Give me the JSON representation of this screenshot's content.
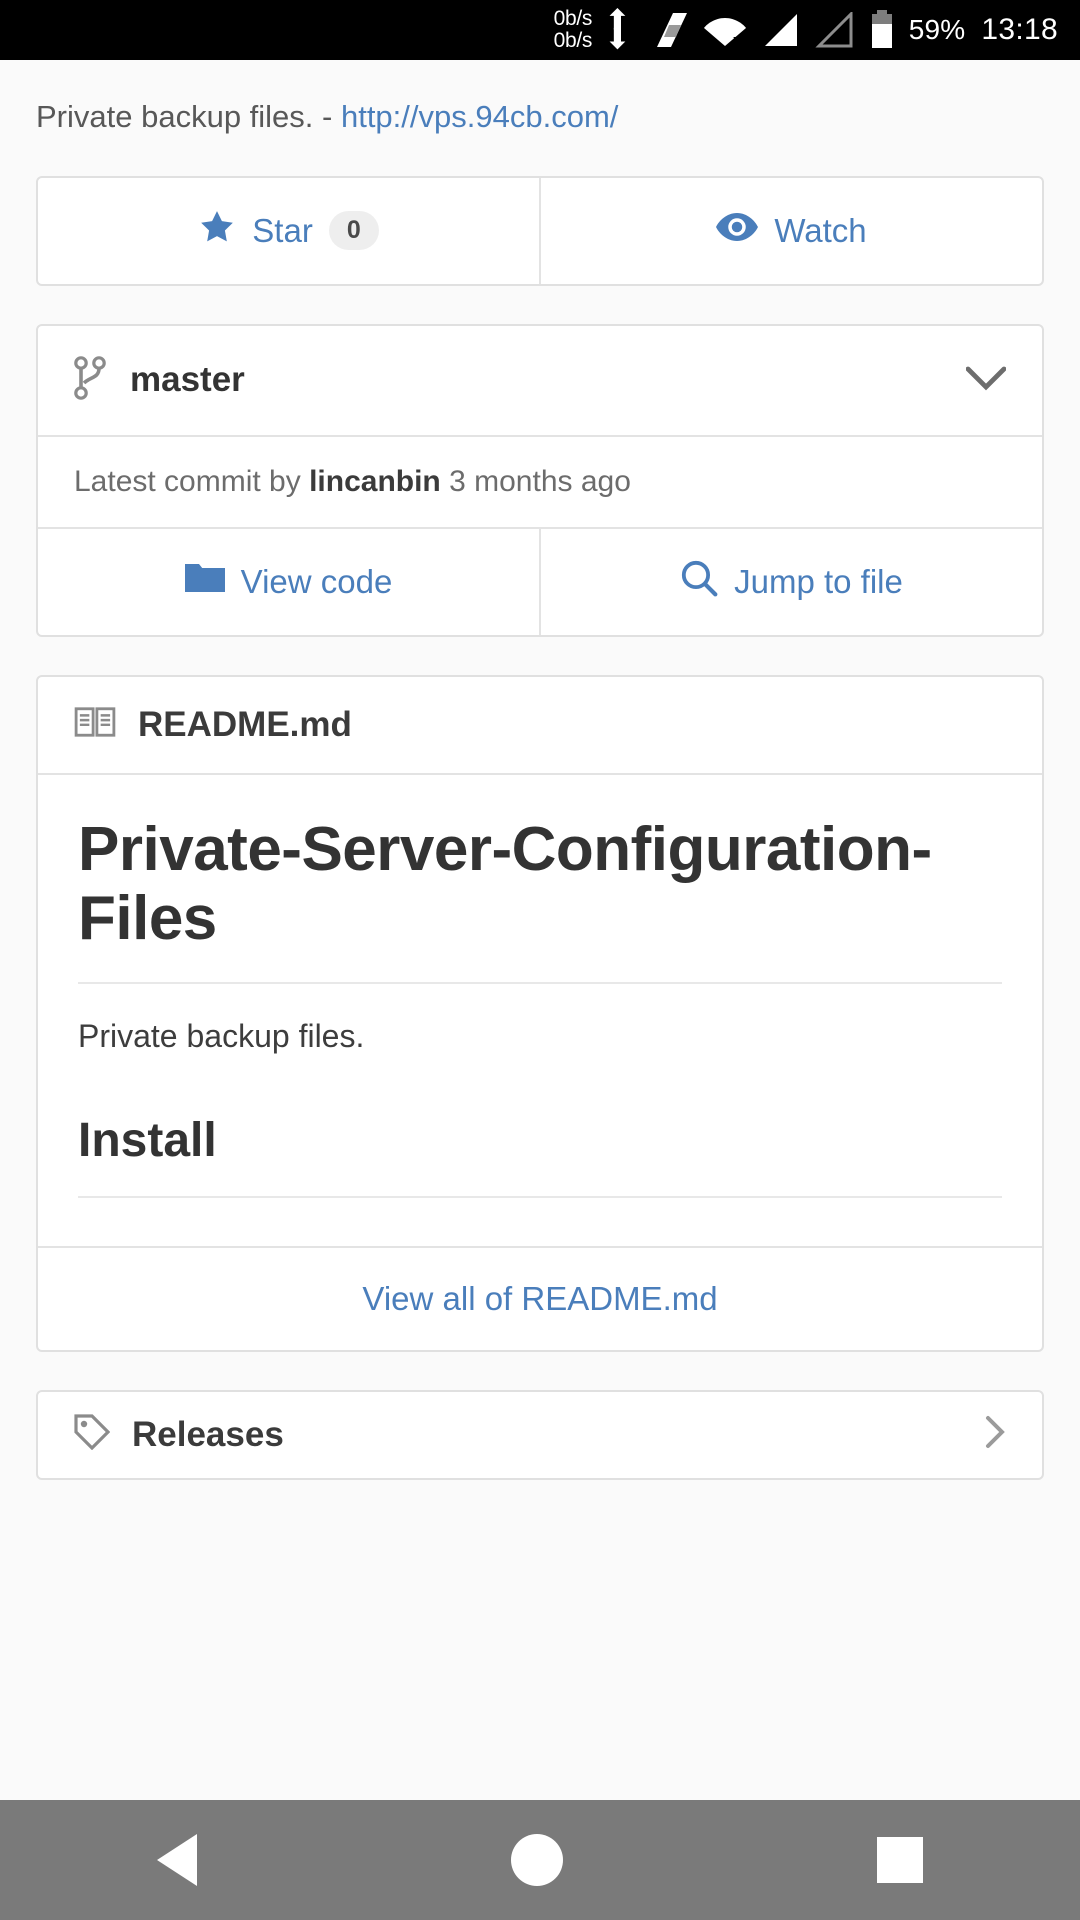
{
  "statusbar": {
    "speed_up": "0b/s",
    "speed_down": "0b/s",
    "battery_percent": "59%",
    "time": "13:18",
    "icons": [
      "network-speed-icon",
      "vpn-icon",
      "wifi-off-icon",
      "signal-full-icon",
      "signal-empty-icon",
      "battery-icon"
    ]
  },
  "repo": {
    "description": "Private backup files. - ",
    "homepage_url": "http://vps.94cb.com/"
  },
  "actions": {
    "star_label": "Star",
    "star_count": "0",
    "watch_label": "Watch"
  },
  "branch": {
    "name": "master",
    "latest_commit_prefix": "Latest commit by ",
    "author": "lincanbin",
    "time_ago": " 3 months ago",
    "view_code_label": "View code",
    "jump_to_file_label": "Jump to file"
  },
  "readme": {
    "filename": "README.md",
    "heading": "Private-Server-Configuration-Files",
    "paragraph": "Private backup files.",
    "subheading": "Install",
    "view_all_label": "View all of README.md"
  },
  "releases": {
    "label": "Releases"
  },
  "navbar": {
    "back_label": "Back",
    "home_label": "Home",
    "recents_label": "Recents"
  },
  "colors": {
    "link": "#4a7ebb",
    "accent": "#4a7ebb",
    "page_bg": "#fafafa",
    "statusbar_bg": "#000000",
    "navbar_bg": "#7a7a7a"
  }
}
